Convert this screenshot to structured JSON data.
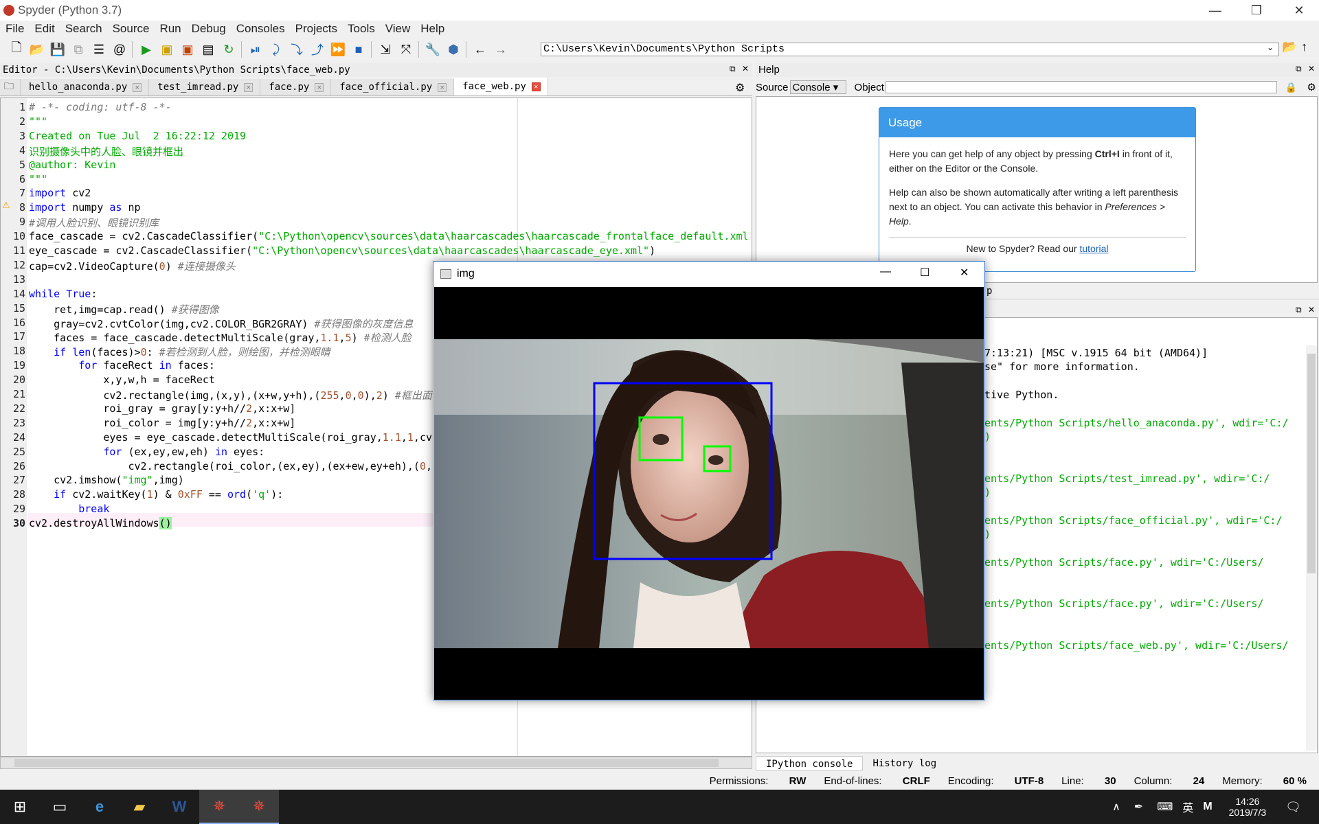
{
  "window": {
    "title": "Spyder (Python 3.7)",
    "min": "—",
    "max": "❐",
    "close": "✕"
  },
  "menu": [
    "File",
    "Edit",
    "Search",
    "Source",
    "Run",
    "Debug",
    "Consoles",
    "Projects",
    "Tools",
    "View",
    "Help"
  ],
  "toolbar": {
    "path": "C:\\Users\\Kevin\\Documents\\Python Scripts"
  },
  "editor": {
    "header": "Editor - C:\\Users\\Kevin\\Documents\\Python Scripts\\face_web.py",
    "tabs": [
      "hello_anaconda.py",
      "test_imread.py",
      "face.py",
      "face_official.py",
      "face_web.py"
    ],
    "active_tab": 4,
    "current_line": "30"
  },
  "help": {
    "header": "Help",
    "source_label": "Source",
    "source_value": "Console",
    "object_label": "Object",
    "usage_title": "Usage",
    "p1a": "Here you can get help of any object by pressing ",
    "p1b": "Ctrl+I",
    "p1c": " in front of it, either on the Editor or the Console.",
    "p2a": "Help can also be shown automatically after writing a left parenthesis next to an object. You can activate this behavior in ",
    "p2b": "Preferences > Help",
    "p2c": ".",
    "p3a": "New to Spyder? Read our ",
    "p3b": "tutorial",
    "clipped_tab": "p"
  },
  "console": {
    "lines": [
      {
        "t": "7:13:21) [MSC v.1915 64 bit (AMD64)]",
        "c": "#000"
      },
      {
        "t": "se\" for more information.",
        "c": "#000"
      },
      {
        "t": "",
        "c": "#000"
      },
      {
        "t": "tive Python.",
        "c": "#000"
      },
      {
        "t": "",
        "c": "#000"
      },
      {
        "t": "ents/Python Scripts/hello_anaconda.py', wdir='C:/",
        "c": "#00aa00"
      },
      {
        "t": ")",
        "c": "#00aa00"
      },
      {
        "t": "",
        "c": "#000"
      },
      {
        "t": "",
        "c": "#000"
      },
      {
        "t": "ents/Python Scripts/test_imread.py', wdir='C:/",
        "c": "#00aa00"
      },
      {
        "t": ")",
        "c": "#00aa00"
      },
      {
        "t": "",
        "c": "#000"
      },
      {
        "t": "ents/Python Scripts/face_official.py', wdir='C:/",
        "c": "#00aa00"
      },
      {
        "t": ")",
        "c": "#00aa00"
      },
      {
        "t": "",
        "c": "#000"
      },
      {
        "t": "ents/Python Scripts/face.py', wdir='C:/Users/",
        "c": "#00aa00"
      },
      {
        "t": "",
        "c": "#000"
      },
      {
        "t": "",
        "c": "#000"
      },
      {
        "t": "ents/Python Scripts/face.py', wdir='C:/Users/",
        "c": "#00aa00"
      },
      {
        "t": "",
        "c": "#000"
      },
      {
        "t": "",
        "c": "#000"
      },
      {
        "t": "ents/Python Scripts/face_web.py', wdir='C:/Users/",
        "c": "#00aa00"
      }
    ],
    "tabs": [
      "IPython console",
      "History log"
    ]
  },
  "status": {
    "permissions_label": "Permissions:",
    "permissions": "RW",
    "eol_label": "End-of-lines:",
    "eol": "CRLF",
    "encoding_label": "Encoding:",
    "encoding": "UTF-8",
    "line_label": "Line:",
    "line": "30",
    "column_label": "Column:",
    "column": "24",
    "memory_label": "Memory:",
    "memory": "60 %"
  },
  "imgwin": {
    "title": "img"
  },
  "taskbar": {
    "time": "14:26",
    "date": "2019/7/3",
    "ime": "英",
    "ime2": "M"
  }
}
